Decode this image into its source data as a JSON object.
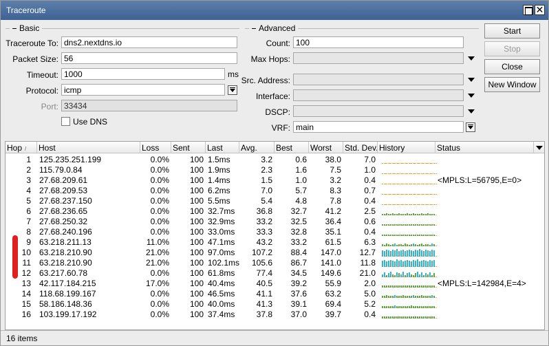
{
  "window": {
    "title": "Traceroute"
  },
  "basic": {
    "heading": "Basic",
    "traceroute_to_label": "Traceroute To:",
    "traceroute_to": "dns2.nextdns.io",
    "packet_size_label": "Packet Size:",
    "packet_size": "56",
    "timeout_label": "Timeout:",
    "timeout": "1000",
    "timeout_unit": "ms",
    "protocol_label": "Protocol:",
    "protocol": "icmp",
    "port_label": "Port:",
    "port": "33434",
    "use_dns_label": "Use DNS"
  },
  "advanced": {
    "heading": "Advanced",
    "count_label": "Count:",
    "count": "100",
    "max_hops_label": "Max Hops:",
    "src_address_label": "Src. Address:",
    "interface_label": "Interface:",
    "dscp_label": "DSCP:",
    "vrf_label": "VRF:",
    "vrf": "main"
  },
  "buttons": {
    "start": "Start",
    "stop": "Stop",
    "close": "Close",
    "new_window": "New Window"
  },
  "table": {
    "columns": [
      "Hop",
      "Host",
      "Loss",
      "Sent",
      "Last",
      "Avg.",
      "Best",
      "Worst",
      "Std. Dev.",
      "History",
      "Status"
    ],
    "rows": [
      {
        "hop": "1",
        "host": "125.235.251.199",
        "loss": "0.0%",
        "sent": "100",
        "last": "1.5ms",
        "avg": "3.2",
        "best": "0.6",
        "worst": "38.0",
        "std": "7.0",
        "status": "",
        "history": [
          1,
          1,
          1,
          1,
          1,
          1,
          1,
          1,
          1,
          1,
          1,
          1,
          1,
          1,
          1,
          1,
          1,
          1,
          1,
          1,
          1,
          1,
          1,
          1,
          1,
          1
        ]
      },
      {
        "hop": "2",
        "host": "115.79.0.84",
        "loss": "0.0%",
        "sent": "100",
        "last": "1.9ms",
        "avg": "2.3",
        "best": "1.6",
        "worst": "7.5",
        "std": "1.0",
        "status": "",
        "history": [
          1,
          1,
          1,
          1,
          1,
          1,
          1,
          1,
          1,
          1,
          1,
          1,
          1,
          1,
          1,
          1,
          1,
          1,
          1,
          1,
          1,
          1,
          1,
          1,
          1,
          1
        ]
      },
      {
        "hop": "3",
        "host": "27.68.209.61",
        "loss": "0.0%",
        "sent": "100",
        "last": "1.4ms",
        "avg": "1.5",
        "best": "1.0",
        "worst": "3.2",
        "std": "0.4",
        "status": "<MPLS:L=56795,E=0>",
        "history": [
          1,
          1,
          1,
          1,
          1,
          1,
          1,
          1,
          1,
          1,
          1,
          1,
          1,
          1,
          1,
          1,
          1,
          1,
          1,
          1,
          1,
          1,
          1,
          1,
          1,
          1
        ]
      },
      {
        "hop": "4",
        "host": "27.68.209.53",
        "loss": "0.0%",
        "sent": "100",
        "last": "6.2ms",
        "avg": "7.0",
        "best": "5.7",
        "worst": "8.3",
        "std": "0.7",
        "status": "",
        "history": [
          1,
          1,
          1,
          1,
          1,
          1,
          1,
          1,
          1,
          1,
          1,
          1,
          1,
          1,
          1,
          1,
          1,
          1,
          1,
          1,
          1,
          1,
          1,
          1,
          1,
          1
        ]
      },
      {
        "hop": "5",
        "host": "27.68.237.150",
        "loss": "0.0%",
        "sent": "100",
        "last": "5.5ms",
        "avg": "5.4",
        "best": "4.8",
        "worst": "7.8",
        "std": "0.4",
        "status": "",
        "history": [
          1,
          1,
          1,
          1,
          1,
          1,
          1,
          1,
          1,
          1,
          1,
          1,
          1,
          1,
          1,
          1,
          1,
          1,
          1,
          1,
          1,
          1,
          1,
          1,
          1,
          1
        ]
      },
      {
        "hop": "6",
        "host": "27.68.236.65",
        "loss": "0.0%",
        "sent": "100",
        "last": "32.7ms",
        "avg": "36.8",
        "best": "32.7",
        "worst": "41.2",
        "std": "2.5",
        "status": "",
        "history": [
          2,
          2,
          3,
          2,
          2,
          3,
          2,
          2,
          3,
          2,
          2,
          2,
          3,
          2,
          2,
          3,
          2,
          2,
          2,
          3,
          2,
          2,
          3,
          2,
          2,
          2
        ]
      },
      {
        "hop": "7",
        "host": "27.68.250.32",
        "loss": "0.0%",
        "sent": "100",
        "last": "32.9ms",
        "avg": "33.2",
        "best": "32.5",
        "worst": "36.4",
        "std": "0.6",
        "status": "",
        "history": [
          2,
          2,
          2,
          2,
          2,
          2,
          2,
          2,
          2,
          2,
          2,
          2,
          2,
          2,
          2,
          2,
          2,
          2,
          2,
          2,
          2,
          2,
          2,
          2,
          2,
          2
        ]
      },
      {
        "hop": "8",
        "host": "27.68.240.196",
        "loss": "0.0%",
        "sent": "100",
        "last": "33.0ms",
        "avg": "33.3",
        "best": "32.8",
        "worst": "35.1",
        "std": "0.4",
        "status": "",
        "history": [
          2,
          2,
          2,
          2,
          2,
          2,
          2,
          2,
          2,
          2,
          2,
          2,
          2,
          2,
          2,
          2,
          2,
          2,
          2,
          2,
          2,
          2,
          2,
          2,
          2,
          2
        ]
      },
      {
        "hop": "9",
        "host": "63.218.211.13",
        "loss": "11.0%",
        "sent": "100",
        "last": "47.1ms",
        "avg": "43.2",
        "best": "33.2",
        "worst": "61.5",
        "std": "6.3",
        "status": "",
        "history": [
          3,
          2,
          4,
          3,
          2,
          3,
          4,
          2,
          3,
          3,
          2,
          4,
          3,
          2,
          3,
          4,
          3,
          2,
          3,
          4,
          2,
          3,
          3,
          2,
          4,
          3
        ]
      },
      {
        "hop": "10",
        "host": "63.218.210.90",
        "loss": "21.0%",
        "sent": "100",
        "last": "97.0ms",
        "avg": "107.2",
        "best": "88.4",
        "worst": "147.0",
        "std": "12.7",
        "status": "",
        "history": [
          8,
          7,
          9,
          8,
          7,
          9,
          8,
          10,
          7,
          8,
          9,
          7,
          8,
          9,
          8,
          7,
          9,
          8,
          10,
          8,
          7,
          9,
          8,
          7,
          9,
          8
        ]
      },
      {
        "hop": "11",
        "host": "63.218.210.90",
        "loss": "21.0%",
        "sent": "100",
        "last": "102.1ms",
        "avg": "105.6",
        "best": "86.7",
        "worst": "141.0",
        "std": "11.8",
        "status": "",
        "history": [
          8,
          9,
          7,
          8,
          9,
          8,
          7,
          10,
          8,
          9,
          7,
          8,
          9,
          8,
          7,
          9,
          8,
          10,
          7,
          8,
          9,
          8,
          7,
          9,
          8,
          9
        ]
      },
      {
        "hop": "12",
        "host": "63.217.60.78",
        "loss": "0.0%",
        "sent": "100",
        "last": "61.8ms",
        "avg": "77.4",
        "best": "34.5",
        "worst": "149.6",
        "std": "21.0",
        "status": "",
        "history": [
          4,
          6,
          3,
          5,
          7,
          4,
          3,
          6,
          5,
          4,
          7,
          3,
          5,
          6,
          4,
          3,
          5,
          7,
          4,
          6,
          3,
          5,
          4,
          6,
          3,
          5
        ]
      },
      {
        "hop": "13",
        "host": "42.117.184.215",
        "loss": "17.0%",
        "sent": "100",
        "last": "40.4ms",
        "avg": "40.5",
        "best": "39.2",
        "worst": "55.9",
        "std": "2.0",
        "status": "<MPLS:L=142984,E=4>",
        "history": [
          3,
          3,
          3,
          3,
          3,
          3,
          3,
          3,
          3,
          3,
          3,
          3,
          3,
          3,
          3,
          3,
          3,
          3,
          3,
          3,
          3,
          3,
          3,
          3,
          3,
          3
        ]
      },
      {
        "hop": "14",
        "host": "118.68.199.167",
        "loss": "0.0%",
        "sent": "100",
        "last": "46.5ms",
        "avg": "41.1",
        "best": "37.6",
        "worst": "63.2",
        "std": "5.0",
        "status": "",
        "history": [
          3,
          3,
          4,
          3,
          3,
          3,
          4,
          3,
          3,
          3,
          4,
          3,
          3,
          3,
          3,
          4,
          3,
          3,
          3,
          4,
          3,
          3,
          3,
          3,
          4,
          3
        ]
      },
      {
        "hop": "15",
        "host": "58.186.148.36",
        "loss": "0.0%",
        "sent": "100",
        "last": "40.0ms",
        "avg": "41.3",
        "best": "39.1",
        "worst": "69.4",
        "std": "5.2",
        "status": "",
        "history": [
          3,
          3,
          3,
          3,
          3,
          3,
          4,
          3,
          3,
          3,
          3,
          3,
          3,
          3,
          4,
          3,
          3,
          3,
          3,
          3,
          3,
          3,
          3,
          3,
          3,
          3
        ]
      },
      {
        "hop": "16",
        "host": "103.199.17.192",
        "loss": "0.0%",
        "sent": "100",
        "last": "37.4ms",
        "avg": "37.8",
        "best": "37.0",
        "worst": "39.7",
        "std": "0.4",
        "status": "",
        "history": [
          3,
          3,
          3,
          3,
          3,
          3,
          3,
          3,
          3,
          3,
          3,
          3,
          3,
          3,
          3,
          3,
          3,
          3,
          3,
          3,
          3,
          3,
          3,
          3,
          3,
          3
        ]
      }
    ]
  },
  "status_bar": {
    "items": "16 items"
  },
  "colors": {
    "history_green": "#5aa544",
    "history_teal": "#36b3c8",
    "history_orange": "#f0a030",
    "annotation_red": "#e02020"
  }
}
